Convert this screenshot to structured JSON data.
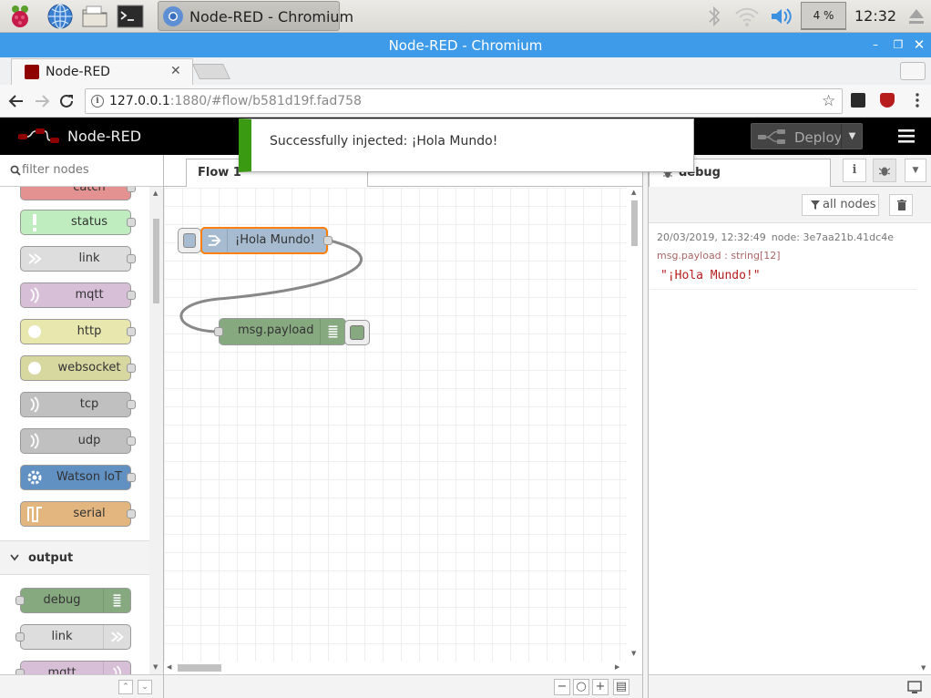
{
  "os": {
    "taskbar_task_title": "Node-RED - Chromium",
    "cpu_percent": "4 %",
    "clock": "12:32",
    "icons": [
      "raspberry-pi-menu-icon",
      "globe-icon",
      "folder-icon",
      "terminal-icon",
      "chromium-icon",
      "bluetooth-icon",
      "wifi-icon",
      "volume-icon",
      "eject-icon"
    ]
  },
  "browser": {
    "window_title": "Node-RED - Chromium",
    "tab_title": "Node-RED",
    "url_host": "127.0.0.1",
    "url_rest": ":1880/#flow/b581d19f.fad758"
  },
  "app": {
    "brand": "Node-RED",
    "deploy_label": "Deploy",
    "accent_color": "#8f0000"
  },
  "notification": {
    "text": "Successfully injected: ¡Hola Mundo!",
    "color": "#3a9a12"
  },
  "palette": {
    "search_placeholder": "filter nodes",
    "nodes": [
      {
        "label": "catch",
        "color": "#e49191"
      },
      {
        "label": "status",
        "color": "#c0edc0"
      },
      {
        "label": "link",
        "color": "#dddddd"
      },
      {
        "label": "mqtt",
        "color": "#d8bfd8"
      },
      {
        "label": "http",
        "color": "#e7e7ae"
      },
      {
        "label": "websocket",
        "color": "#d7d7a0"
      },
      {
        "label": "tcp",
        "color": "#c0c0c0"
      },
      {
        "label": "udp",
        "color": "#c0c0c0"
      },
      {
        "label": "Watson IoT",
        "color": "#6190c3"
      },
      {
        "label": "serial",
        "color": "#e3b57f"
      }
    ],
    "output_category": "output",
    "output_nodes": [
      {
        "label": "debug",
        "color": "#87a980"
      },
      {
        "label": "link",
        "color": "#dddddd"
      },
      {
        "label": "mqtt",
        "color": "#d8bfd8"
      }
    ]
  },
  "workspace": {
    "tab_label": "Flow 1",
    "inject_node_label": "¡Hola Mundo!",
    "debug_node_label": "msg.payload"
  },
  "sidebar": {
    "tab_label": "debug",
    "filter_label": "all nodes",
    "message": {
      "timestamp": "20/03/2019, 12:32:49",
      "node": "node: 3e7aa21b.41dc4e",
      "topic": "msg.payload : string[12]",
      "value": "\"¡Hola Mundo!\""
    }
  }
}
